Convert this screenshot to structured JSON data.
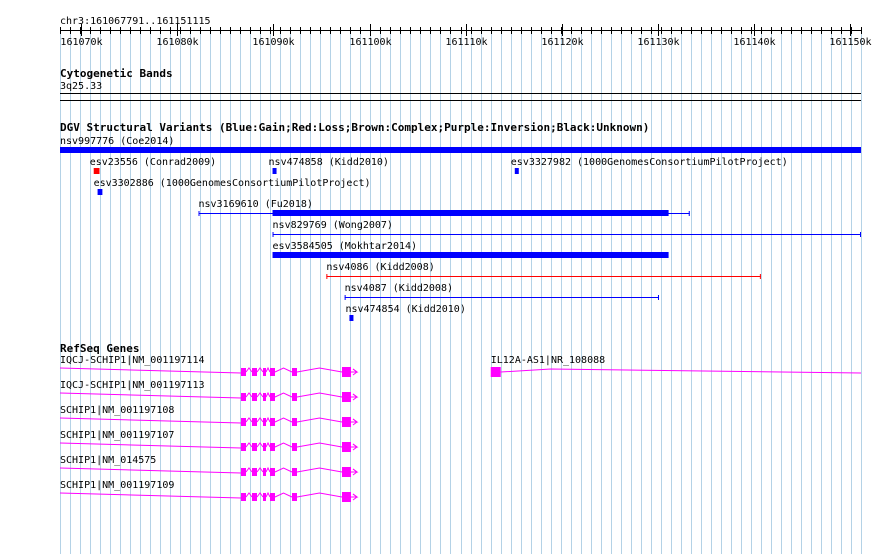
{
  "region": {
    "label": "chr3:161067791..161151115",
    "start": 161067791,
    "end": 161151115,
    "ticks": [
      {
        "pos": 161070000,
        "label": "161070k"
      },
      {
        "pos": 161080000,
        "label": "161080k"
      },
      {
        "pos": 161090000,
        "label": "161090k"
      },
      {
        "pos": 161100000,
        "label": "161100k"
      },
      {
        "pos": 161110000,
        "label": "161110k"
      },
      {
        "pos": 161120000,
        "label": "161120k"
      },
      {
        "pos": 161130000,
        "label": "161130k"
      },
      {
        "pos": 161140000,
        "label": "161140k"
      },
      {
        "pos": 161150000,
        "label": "161150k"
      }
    ]
  },
  "cytobands": {
    "title": "Cytogenetic Bands",
    "band": "3q25.33"
  },
  "dgv": {
    "title": "DGV Structural Variants (Blue:Gain;Red:Loss;Brown:Complex;Purple:Inversion;Black:Unknown)",
    "colors": {
      "gain": "#0000ff",
      "loss": "#ff0000"
    },
    "variants": [
      {
        "id": "nsv997776",
        "label": "nsv997776 (Coe2014)",
        "type": "gain",
        "style": "bar",
        "start": 161067791,
        "end": 161151115
      },
      {
        "id": "esv23556",
        "label": "esv23556 (Conrad2009)",
        "type": "loss",
        "style": "bar",
        "start": 161071300,
        "end": 161071900
      },
      {
        "id": "nsv474858",
        "label": "nsv474858 (Kidd2010)",
        "type": "gain",
        "style": "bar",
        "start": 161089900,
        "end": 161090100
      },
      {
        "id": "esv3327982",
        "label": "esv3327982 (1000GenomesConsortiumPilotProject)",
        "type": "gain",
        "style": "bar",
        "start": 161115100,
        "end": 161115300
      },
      {
        "id": "esv3302886",
        "label": "esv3302886 (1000GenomesConsortiumPilotProject)",
        "type": "gain",
        "style": "bar",
        "start": 161071700,
        "end": 161072200
      },
      {
        "id": "nsv3169610",
        "label": "nsv3169610 (Fu2018)",
        "type": "gain",
        "style": "thickline",
        "start": 161082200,
        "end": 161133300,
        "thick_start": 161089900,
        "thick_end": 161131100
      },
      {
        "id": "nsv829769",
        "label": "nsv829769 (Wong2007)",
        "type": "gain",
        "style": "line",
        "start": 161089900,
        "end": 161151115
      },
      {
        "id": "esv3584505",
        "label": "esv3584505 (Mokhtar2014)",
        "type": "gain",
        "style": "bar",
        "start": 161089900,
        "end": 161131100
      },
      {
        "id": "nsv4086",
        "label": "nsv4086 (Kidd2008)",
        "type": "loss",
        "style": "line",
        "start": 161095500,
        "end": 161140700
      },
      {
        "id": "nsv4087",
        "label": "nsv4087 (Kidd2008)",
        "type": "gain",
        "style": "line",
        "start": 161097400,
        "end": 161130100
      },
      {
        "id": "nsv474854",
        "label": "nsv474854 (Kidd2010)",
        "type": "gain",
        "style": "bar",
        "start": 161097900,
        "end": 161098100
      }
    ]
  },
  "refseq": {
    "title": "RefSeq Genes",
    "color": "#ff00ff",
    "genes": [
      {
        "label": "IQCJ-SCHIP1|NM_001197114",
        "start": 161067791,
        "end": 161097300
      },
      {
        "label": "IQCJ-SCHIP1|NM_001197113",
        "start": 161067791,
        "end": 161097300
      },
      {
        "label": "SCHIP1|NM_001197108",
        "start": 161067791,
        "end": 161097300
      },
      {
        "label": "SCHIP1|NM_001197107",
        "start": 161067791,
        "end": 161097300
      },
      {
        "label": "SCHIP1|NM_014575",
        "start": 161067791,
        "end": 161097300
      },
      {
        "label": "SCHIP1|NM_001197109",
        "start": 161067791,
        "end": 161097300
      },
      {
        "label": "IL12A-AS1|NR_108088",
        "start": 161112600,
        "end": 161151115
      }
    ]
  }
}
